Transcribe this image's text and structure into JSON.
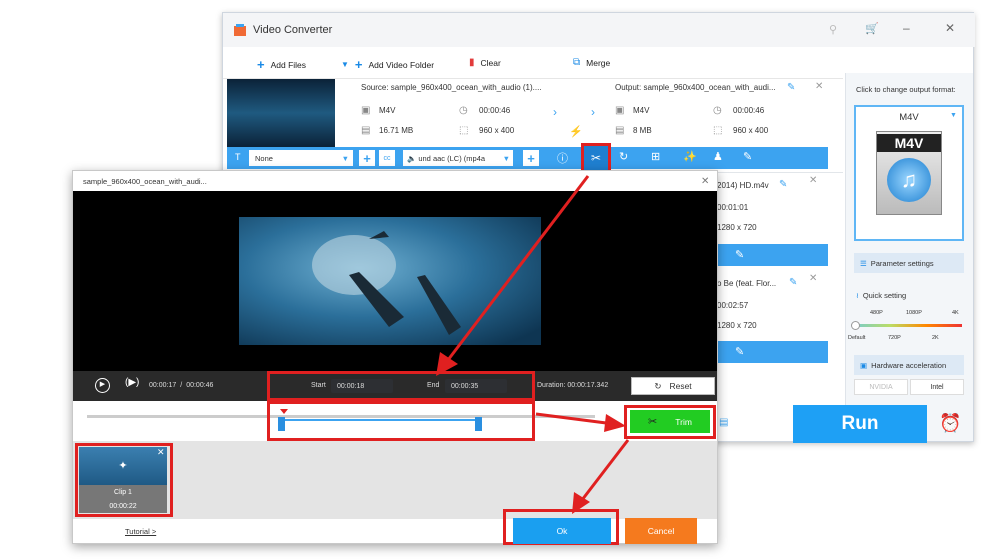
{
  "window": {
    "title": "Video Converter"
  },
  "toolbar": {
    "add_files": "Add Files",
    "add_folder": "Add Video Folder",
    "clear": "Clear",
    "merge": "Merge"
  },
  "file": {
    "source_label": "Source: sample_960x400_ocean_with_audio (1)....",
    "source_format": "M4V",
    "source_duration": "00:00:46",
    "source_size": "16.71 MB",
    "source_res": "960 x 400",
    "output_label": "Output: sample_960x400_ocean_with_audi...",
    "output_format": "M4V",
    "output_duration": "00:00:46",
    "output_size": "8 MB",
    "output_res": "960 x 400",
    "subtitle": "None",
    "audio": "und aac (LC) (mp4a"
  },
  "row2": {
    "output_tail": "2014) HD.m4v",
    "duration": "00:01:01",
    "res": "1280 x 720"
  },
  "row3": {
    "output_tail": "o Be (feat. Flor...",
    "duration": "00:02:57",
    "res": "1280 x 720"
  },
  "sidebar": {
    "prompt": "Click to change output format:",
    "format": "M4V",
    "format_art": "M4V",
    "parameter_settings": "Parameter settings",
    "quick_setting": "Quick setting",
    "ticks_top": [
      "480P",
      "1080P",
      "4K"
    ],
    "ticks_bottom": [
      "Default",
      "720P",
      "2K"
    ],
    "hardware_accel": "Hardware acceleration",
    "nvidia": "NVIDIA",
    "intel": "Intel"
  },
  "run": "Run",
  "dialog": {
    "title": "sample_960x400_ocean_with_audi...",
    "current_time": "00:00:17",
    "sep": "/",
    "total_time": "00:00:46",
    "start_label": "Start",
    "start_value": "00:00:18",
    "end_label": "End",
    "end_value": "00:00:35",
    "duration_text": "Duration: 00:00:17.342",
    "reset": "Reset",
    "trim": "Trim",
    "clip_name": "Clip 1",
    "clip_duration": "00:00:22",
    "tutorial": "Tutorial >",
    "ok": "Ok",
    "cancel": "Cancel"
  },
  "colors": {
    "accent": "#3ca3f0",
    "run": "#1ea0f5",
    "trim": "#22cc22",
    "ok": "#1a9ff0",
    "cancel": "#f57a1e",
    "highlight": "#e02020"
  }
}
